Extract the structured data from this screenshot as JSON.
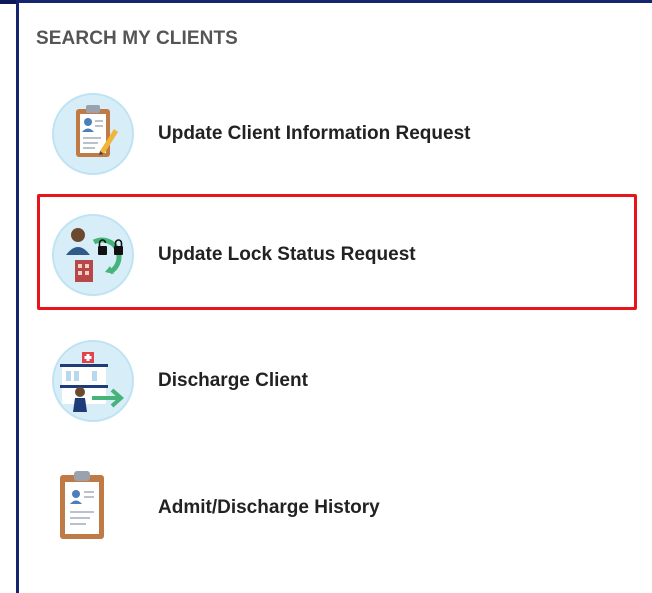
{
  "section": {
    "title": "SEARCH MY CLIENTS"
  },
  "items": [
    {
      "label": "Update Client Information Request",
      "icon": "clipboard-edit-icon"
    },
    {
      "label": "Update Lock Status Request",
      "icon": "lock-status-icon"
    },
    {
      "label": "Discharge Client",
      "icon": "discharge-client-icon"
    },
    {
      "label": "Admit/Discharge History",
      "icon": "history-clipboard-icon"
    }
  ],
  "colors": {
    "border": "#15266e",
    "highlight": "#e8141c",
    "icon_bg": "#d7eef8"
  }
}
